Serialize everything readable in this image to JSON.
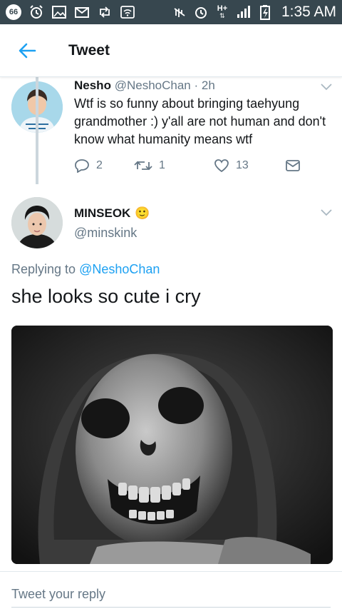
{
  "status_bar": {
    "notification_count": "66",
    "network": "H+",
    "time": "1:35 AM"
  },
  "app_bar": {
    "title": "Tweet"
  },
  "parent_tweet": {
    "name": "Nesho",
    "handle": "@NeshoChan",
    "separator": "·",
    "time": "2h",
    "text": "Wtf is so funny about bringing taehyung grandmother :) y'all are not human and don't know what humanity means wtf",
    "replies": "2",
    "retweets": "1",
    "likes": "13"
  },
  "focused_tweet": {
    "name": "MINSEOK",
    "emoji": "🙂",
    "handle": "@minskink",
    "replying_prefix": "Replying to",
    "replying_to": "@NeshoChan",
    "text": "she looks so cute i cry"
  },
  "reply_box": {
    "placeholder": "Tweet your reply"
  },
  "colors": {
    "accent": "#1da1f2",
    "secondary_text": "#657786",
    "status_bar": "#37474f"
  }
}
